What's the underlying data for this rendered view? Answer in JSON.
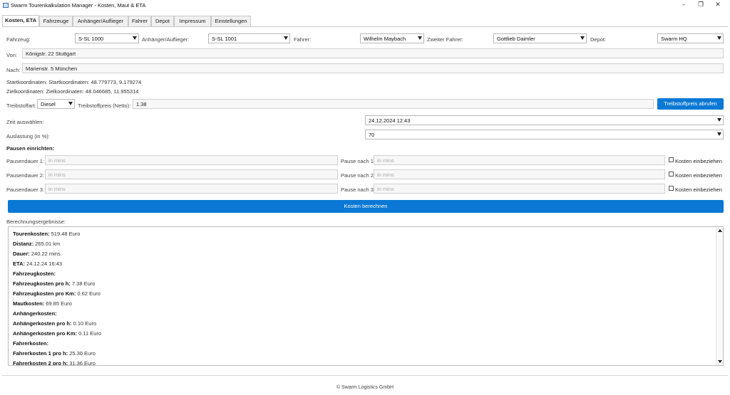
{
  "window": {
    "title": "Swarm Tourenkalkulation Manager - Kosten, Maut & ETA",
    "minimize": "–",
    "maximize": "❐",
    "close": "✕"
  },
  "tabs": [
    {
      "label": "Kosten, ETA"
    },
    {
      "label": "Fahrzeuge"
    },
    {
      "label": "Anhänger/Auflieger"
    },
    {
      "label": "Fahrer"
    },
    {
      "label": "Depot"
    },
    {
      "label": "Impressum"
    },
    {
      "label": "Einstellungen"
    }
  ],
  "selection": {
    "vehicle_label": "Fahrzeug:",
    "vehicle_value": "S-SL 1000",
    "trailer_label": "Anhänger/Auflieger:",
    "trailer_value": "S-SL 1001",
    "driver_label": "Fahrer:",
    "driver_value": "Wilhelm Maybach",
    "second_driver_label": "Zweiter Fahrer:",
    "second_driver_value": "Gottlieb Daimler",
    "depot_label": "Depot:",
    "depot_value": "Swarm HQ"
  },
  "route": {
    "from_label": "Von:",
    "from_value": "Königstr. 22 Stuttgart",
    "to_label": "Nach:",
    "to_value": "Marienstr. 5 München",
    "start_coords": "Startkoordinaten:  Startkoordinaten: 48.779773, 9.179274",
    "end_coords": "Zielkoordinaten:   Zielkoordinaten: 48.046685, 11.955314"
  },
  "fuel": {
    "type_label": "Treibstoffart:",
    "type_value": "Diesel",
    "price_label": "Treibstoffpreis (Netto):",
    "price_value": "1.38",
    "fetch_button": "Treibstoffpreis abrufen"
  },
  "time": {
    "label": "Zeit auswählen:",
    "value": "24.12.2024 12:43"
  },
  "load": {
    "label": "Auslastung (in %):",
    "value": "70"
  },
  "pauses": {
    "heading": "Pausen einrichten:",
    "rows": [
      {
        "duration_label": "Pausendauer 1:",
        "after_label": "Pause nach 1:",
        "placeholder": "in mins",
        "include_label": "Kosten einbeziehen"
      },
      {
        "duration_label": "Pausendauer 2:",
        "after_label": "Pause nach 2:",
        "placeholder": "in mins",
        "include_label": "Kosten einbeziehen"
      },
      {
        "duration_label": "Pausendauer 3:",
        "after_label": "Pause nach 3:",
        "placeholder": "in mins",
        "include_label": "Kosten einbeziehen"
      }
    ]
  },
  "calculate_button": "Kosten berechnen",
  "results": {
    "label": "Berechnungsergebnisse:",
    "lines": [
      {
        "key": "Tourenkosten:",
        "value": " 519.48 Euro"
      },
      {
        "key": "Distanz:",
        "value": " 265.01 km"
      },
      {
        "key": "Dauer:",
        "value": " 240.22 mins"
      },
      {
        "key": "ETA:",
        "value": " 24.12.24 16:43"
      },
      {
        "key": "Fahrzeugkosten:",
        "value": ""
      },
      {
        "key": "Fahrzeugkosten pro h:",
        "value": " 7.38 Euro"
      },
      {
        "key": "Fahrzeugkosten pro Km:",
        "value": " 0.62 Euro"
      },
      {
        "key": "Mautkosten:",
        "value": " 69.85 Euro"
      },
      {
        "key": "Anhängerkosten:",
        "value": ""
      },
      {
        "key": "Anhängerkosten pro h:",
        "value": " 0.10 Euro"
      },
      {
        "key": "Anhängerkosten pro Km:",
        "value": " 0.11 Euro"
      },
      {
        "key": "Fahrerkosten:",
        "value": ""
      },
      {
        "key": "Fahrerkosten 1 pro h:",
        "value": " 25.30 Euro"
      },
      {
        "key": "Fahrerkosten 2 pro h:",
        "value": " 31.36 Euro"
      }
    ]
  },
  "footer": "© Swarm Logistics GmbH",
  "colors": {
    "accent": "#0a78d4"
  }
}
